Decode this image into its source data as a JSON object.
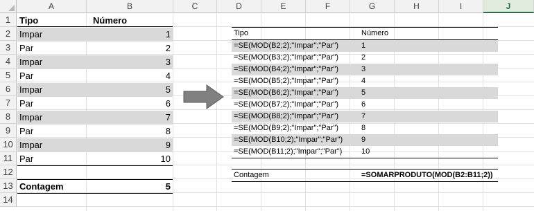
{
  "columns": [
    "A",
    "B",
    "C",
    "D",
    "E",
    "F",
    "G",
    "H",
    "I",
    "J"
  ],
  "selected_column": "J",
  "rows": [
    "1",
    "2",
    "3",
    "4",
    "5",
    "6",
    "7",
    "8",
    "9",
    "10",
    "11",
    "12",
    "13",
    "14"
  ],
  "left_table": {
    "header": {
      "tipo": "Tipo",
      "numero": "Número"
    },
    "rows": [
      {
        "tipo": "Impar",
        "numero": "1"
      },
      {
        "tipo": "Par",
        "numero": "2"
      },
      {
        "tipo": "Impar",
        "numero": "3"
      },
      {
        "tipo": "Par",
        "numero": "4"
      },
      {
        "tipo": "Impar",
        "numero": "5"
      },
      {
        "tipo": "Par",
        "numero": "6"
      },
      {
        "tipo": "Impar",
        "numero": "7"
      },
      {
        "tipo": "Par",
        "numero": "8"
      },
      {
        "tipo": "Impar",
        "numero": "9"
      },
      {
        "tipo": "Par",
        "numero": "10"
      }
    ],
    "count_label": "Contagem",
    "count_value": "5"
  },
  "right_table": {
    "header": {
      "tipo": "Tipo",
      "numero": "Número"
    },
    "rows": [
      {
        "formula": "=SE(MOD(B2;2);\"Impar\";\"Par\")",
        "numero": "1"
      },
      {
        "formula": "=SE(MOD(B3;2);\"Impar\";\"Par\")",
        "numero": "2"
      },
      {
        "formula": "=SE(MOD(B4;2);\"Impar\";\"Par\")",
        "numero": "3"
      },
      {
        "formula": "=SE(MOD(B5;2);\"Impar\";\"Par\")",
        "numero": "4"
      },
      {
        "formula": "=SE(MOD(B6;2);\"Impar\";\"Par\")",
        "numero": "5"
      },
      {
        "formula": "=SE(MOD(B7;2);\"Impar\";\"Par\")",
        "numero": "6"
      },
      {
        "formula": "=SE(MOD(B8;2);\"Impar\";\"Par\")",
        "numero": "7"
      },
      {
        "formula": "=SE(MOD(B9;2);\"Impar\";\"Par\")",
        "numero": "8"
      },
      {
        "formula": "=SE(MOD(B10;2);\"Impar\";\"Par\")",
        "numero": "9"
      },
      {
        "formula": "=SE(MOD(B11;2);\"Impar\";\"Par\")",
        "numero": "10"
      }
    ],
    "count_label": "Contagem",
    "count_formula": "=SOMARPRODUTO(MOD(B2:B11;2))"
  },
  "arrow_icon": "right-arrow-icon",
  "colors": {
    "band": "#d9d9d9",
    "selected_header": "#217346",
    "arrow_fill": "#808080"
  }
}
